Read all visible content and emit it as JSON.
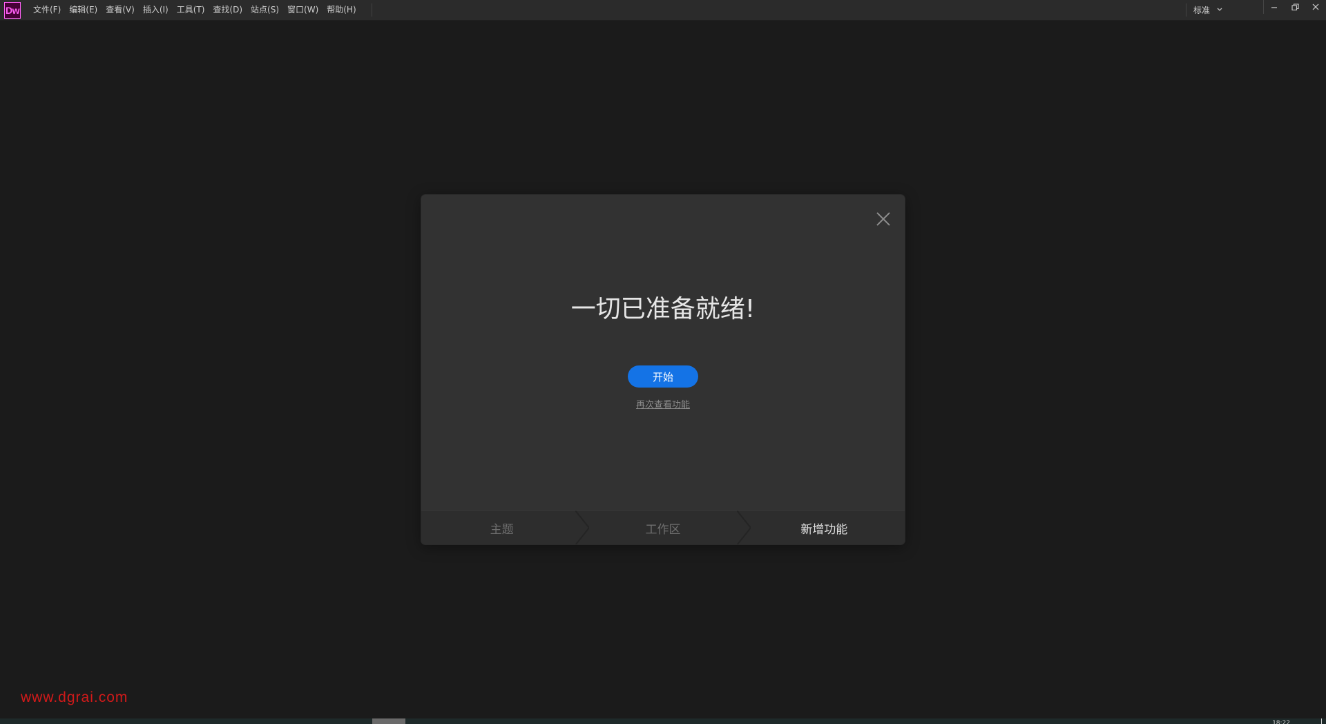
{
  "app": {
    "logo_text": "Dw",
    "logo_color": "#ff61f6",
    "logo_bg": "#470137"
  },
  "menubar": {
    "items": [
      {
        "label": "文件(F)"
      },
      {
        "label": "编辑(E)"
      },
      {
        "label": "查看(V)"
      },
      {
        "label": "插入(I)"
      },
      {
        "label": "工具(T)"
      },
      {
        "label": "查找(D)"
      },
      {
        "label": "站点(S)"
      },
      {
        "label": "窗口(W)"
      },
      {
        "label": "帮助(H)"
      }
    ],
    "workspace": {
      "label": "标准",
      "icon": "chevron-down-icon"
    },
    "window_controls": [
      "minimize-icon",
      "restore-icon",
      "close-icon"
    ]
  },
  "dialog": {
    "title": "一切已准备就绪!",
    "start_button": "开始",
    "replay_link": "再次查看功能",
    "close_icon": "close-icon",
    "accent_color": "#1473e6",
    "steps": [
      {
        "label": "主题",
        "active": false
      },
      {
        "label": "工作区",
        "active": false
      },
      {
        "label": "新增功能",
        "active": true
      }
    ]
  },
  "watermark": {
    "text": "www.dgrai.com",
    "color": "#d11a1a"
  },
  "statusbar": {
    "time": "18:22"
  }
}
